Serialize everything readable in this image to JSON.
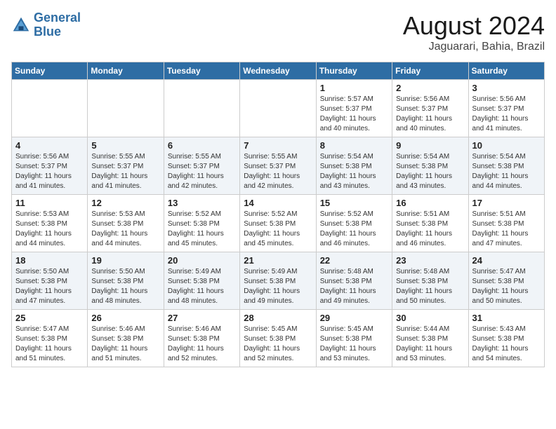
{
  "header": {
    "logo_line1": "General",
    "logo_line2": "Blue",
    "month": "August 2024",
    "location": "Jaguarari, Bahia, Brazil"
  },
  "weekdays": [
    "Sunday",
    "Monday",
    "Tuesday",
    "Wednesday",
    "Thursday",
    "Friday",
    "Saturday"
  ],
  "weeks": [
    [
      {
        "day": "",
        "info": ""
      },
      {
        "day": "",
        "info": ""
      },
      {
        "day": "",
        "info": ""
      },
      {
        "day": "",
        "info": ""
      },
      {
        "day": "1",
        "info": "Sunrise: 5:57 AM\nSunset: 5:37 PM\nDaylight: 11 hours\nand 40 minutes."
      },
      {
        "day": "2",
        "info": "Sunrise: 5:56 AM\nSunset: 5:37 PM\nDaylight: 11 hours\nand 40 minutes."
      },
      {
        "day": "3",
        "info": "Sunrise: 5:56 AM\nSunset: 5:37 PM\nDaylight: 11 hours\nand 41 minutes."
      }
    ],
    [
      {
        "day": "4",
        "info": "Sunrise: 5:56 AM\nSunset: 5:37 PM\nDaylight: 11 hours\nand 41 minutes."
      },
      {
        "day": "5",
        "info": "Sunrise: 5:55 AM\nSunset: 5:37 PM\nDaylight: 11 hours\nand 41 minutes."
      },
      {
        "day": "6",
        "info": "Sunrise: 5:55 AM\nSunset: 5:37 PM\nDaylight: 11 hours\nand 42 minutes."
      },
      {
        "day": "7",
        "info": "Sunrise: 5:55 AM\nSunset: 5:37 PM\nDaylight: 11 hours\nand 42 minutes."
      },
      {
        "day": "8",
        "info": "Sunrise: 5:54 AM\nSunset: 5:38 PM\nDaylight: 11 hours\nand 43 minutes."
      },
      {
        "day": "9",
        "info": "Sunrise: 5:54 AM\nSunset: 5:38 PM\nDaylight: 11 hours\nand 43 minutes."
      },
      {
        "day": "10",
        "info": "Sunrise: 5:54 AM\nSunset: 5:38 PM\nDaylight: 11 hours\nand 44 minutes."
      }
    ],
    [
      {
        "day": "11",
        "info": "Sunrise: 5:53 AM\nSunset: 5:38 PM\nDaylight: 11 hours\nand 44 minutes."
      },
      {
        "day": "12",
        "info": "Sunrise: 5:53 AM\nSunset: 5:38 PM\nDaylight: 11 hours\nand 44 minutes."
      },
      {
        "day": "13",
        "info": "Sunrise: 5:52 AM\nSunset: 5:38 PM\nDaylight: 11 hours\nand 45 minutes."
      },
      {
        "day": "14",
        "info": "Sunrise: 5:52 AM\nSunset: 5:38 PM\nDaylight: 11 hours\nand 45 minutes."
      },
      {
        "day": "15",
        "info": "Sunrise: 5:52 AM\nSunset: 5:38 PM\nDaylight: 11 hours\nand 46 minutes."
      },
      {
        "day": "16",
        "info": "Sunrise: 5:51 AM\nSunset: 5:38 PM\nDaylight: 11 hours\nand 46 minutes."
      },
      {
        "day": "17",
        "info": "Sunrise: 5:51 AM\nSunset: 5:38 PM\nDaylight: 11 hours\nand 47 minutes."
      }
    ],
    [
      {
        "day": "18",
        "info": "Sunrise: 5:50 AM\nSunset: 5:38 PM\nDaylight: 11 hours\nand 47 minutes."
      },
      {
        "day": "19",
        "info": "Sunrise: 5:50 AM\nSunset: 5:38 PM\nDaylight: 11 hours\nand 48 minutes."
      },
      {
        "day": "20",
        "info": "Sunrise: 5:49 AM\nSunset: 5:38 PM\nDaylight: 11 hours\nand 48 minutes."
      },
      {
        "day": "21",
        "info": "Sunrise: 5:49 AM\nSunset: 5:38 PM\nDaylight: 11 hours\nand 49 minutes."
      },
      {
        "day": "22",
        "info": "Sunrise: 5:48 AM\nSunset: 5:38 PM\nDaylight: 11 hours\nand 49 minutes."
      },
      {
        "day": "23",
        "info": "Sunrise: 5:48 AM\nSunset: 5:38 PM\nDaylight: 11 hours\nand 50 minutes."
      },
      {
        "day": "24",
        "info": "Sunrise: 5:47 AM\nSunset: 5:38 PM\nDaylight: 11 hours\nand 50 minutes."
      }
    ],
    [
      {
        "day": "25",
        "info": "Sunrise: 5:47 AM\nSunset: 5:38 PM\nDaylight: 11 hours\nand 51 minutes."
      },
      {
        "day": "26",
        "info": "Sunrise: 5:46 AM\nSunset: 5:38 PM\nDaylight: 11 hours\nand 51 minutes."
      },
      {
        "day": "27",
        "info": "Sunrise: 5:46 AM\nSunset: 5:38 PM\nDaylight: 11 hours\nand 52 minutes."
      },
      {
        "day": "28",
        "info": "Sunrise: 5:45 AM\nSunset: 5:38 PM\nDaylight: 11 hours\nand 52 minutes."
      },
      {
        "day": "29",
        "info": "Sunrise: 5:45 AM\nSunset: 5:38 PM\nDaylight: 11 hours\nand 53 minutes."
      },
      {
        "day": "30",
        "info": "Sunrise: 5:44 AM\nSunset: 5:38 PM\nDaylight: 11 hours\nand 53 minutes."
      },
      {
        "day": "31",
        "info": "Sunrise: 5:43 AM\nSunset: 5:38 PM\nDaylight: 11 hours\nand 54 minutes."
      }
    ]
  ]
}
